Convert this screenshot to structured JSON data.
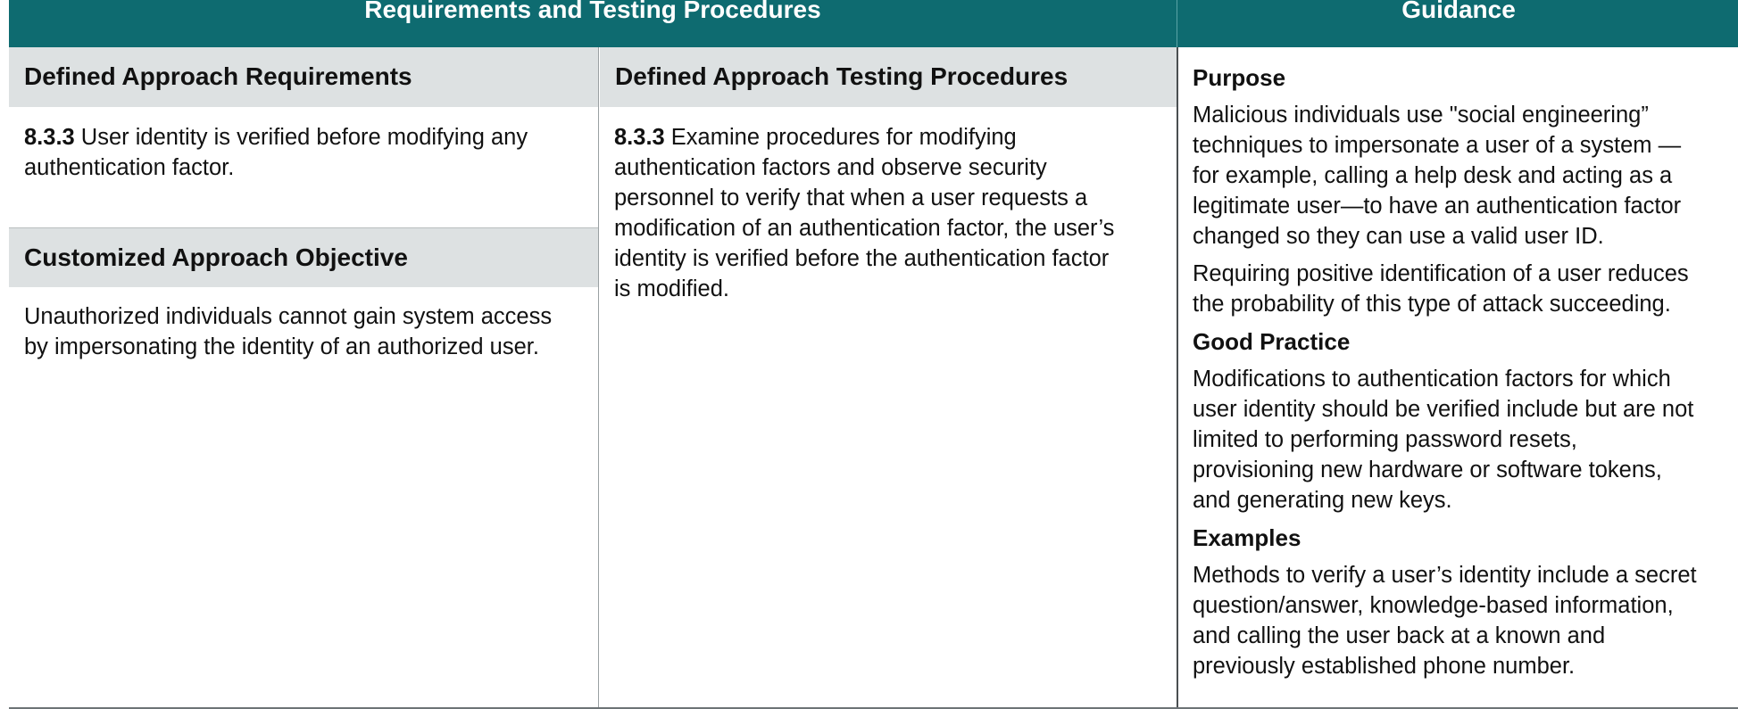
{
  "header": {
    "left_title": "Requirements and Testing Procedures",
    "right_title": "Guidance"
  },
  "requirements": {
    "heading": "Defined Approach Requirements",
    "number": "8.3.3",
    "lines": [
      " User identity is verified before modifying any",
      "authentication factor."
    ]
  },
  "customized": {
    "heading": "Customized Approach Objective",
    "lines": [
      "Unauthorized individuals cannot gain system access",
      "by impersonating the identity of an authorized user."
    ]
  },
  "testing": {
    "heading": "Defined Approach Testing Procedures",
    "number": "8.3.3",
    "lines": [
      " Examine procedures for modifying",
      "authentication factors and observe security",
      "personnel to verify that when a user requests a",
      "modification of an authentication factor, the user’s",
      "identity is verified before the authentication factor",
      "is modified."
    ]
  },
  "guidance": {
    "purpose_heading": "Purpose",
    "purpose_p1": [
      "Malicious individuals use \"social engineering”",
      "techniques to impersonate a user of a system —",
      "for example, calling a help desk and acting as a",
      "legitimate user—to have an authentication factor",
      "changed so they can use a valid user ID."
    ],
    "purpose_p2": [
      "Requiring positive identification of a user reduces",
      "the probability of this type of attack succeeding."
    ],
    "good_practice_heading": "Good Practice",
    "good_practice_p": [
      "Modifications to authentication factors for which",
      "user identity should be verified include but are not",
      "limited to performing password resets,",
      "provisioning new hardware or software tokens,",
      "and generating new keys."
    ],
    "examples_heading": "Examples",
    "examples_p": [
      "Methods to verify a user’s identity include a secret",
      "question/answer, knowledge-based information,",
      "and calling the user back at a known and",
      "previously established phone number."
    ]
  }
}
